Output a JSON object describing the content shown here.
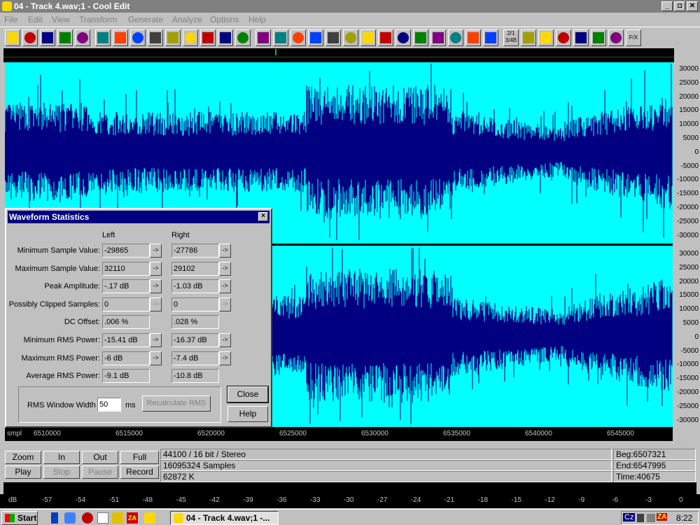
{
  "window": {
    "title": "04 - Track  4.wav;1 - Cool Edit",
    "min": "_",
    "max": "◘",
    "close": "✕"
  },
  "menu": [
    "File",
    "Edit",
    "View",
    "Transform",
    "Generate",
    "Analyze",
    "Options",
    "Help"
  ],
  "toolbar": {
    "time_ratio_top": "2/1",
    "time_ratio_bottom": "3/4B",
    "fx_label": "F/X",
    "icons": [
      "open-icon",
      "folder-icon",
      "save-icon",
      "save-selection-icon",
      "headphones-icon",
      "rewind-icon",
      "stop-bar-icon",
      "loop-icon",
      "note-icon",
      "record-icon",
      "import-icon",
      "silence-icon",
      "envelope-icon",
      "reverb-icon",
      "noise-icon",
      "compressor-icon",
      "filter-icon",
      "echo-icon",
      "flanger-icon",
      "pitch-icon",
      "spectrum-icon",
      "delay-icon",
      "wave-icon",
      "stretch-icon",
      "crossfade-icon",
      "graph-icon",
      "clip-icon",
      "dc-icon",
      "time-icon",
      "help-icon",
      "refresh-icon",
      "meter-icon",
      "scroll-icon",
      "scan-icon",
      "info-icon",
      "bracket-icon"
    ]
  },
  "y_axis_top": [
    "30000",
    "25000",
    "20000",
    "15000",
    "10000",
    "5000",
    "0",
    "-5000",
    "-10000",
    "-15000",
    "-20000",
    "-25000",
    "-30000"
  ],
  "y_axis_bottom": [
    "30000",
    "25000",
    "20000",
    "15000",
    "10000",
    "5000",
    "0",
    "-5000",
    "-10000",
    "-15000",
    "-20000",
    "-25000",
    "-30000"
  ],
  "x_axis": {
    "unit": "smpl",
    "ticks": [
      "6510000",
      "6515000",
      "6520000",
      "6525000",
      "6530000",
      "6535000",
      "6540000",
      "6545000"
    ]
  },
  "controls": {
    "zoom": "Zoom",
    "in": "In",
    "out": "Out",
    "full": "Full",
    "play": "Play",
    "stop": "Stop",
    "pause": "Pause",
    "record": "Record"
  },
  "info": {
    "format": "44100 / 16 bit / Stereo",
    "samples": "16095324 Samples",
    "size": "62872 K",
    "begin": "Beg:6507321",
    "end": "End:6547995",
    "time": "Time:40675"
  },
  "db_scale": [
    "dB",
    "-57",
    "-54",
    "-51",
    "-48",
    "-45",
    "-42",
    "-39",
    "-36",
    "-33",
    "-30",
    "-27",
    "-24",
    "-21",
    "-18",
    "-15",
    "-12",
    "-9",
    "-6",
    "-3",
    "0"
  ],
  "dialog": {
    "title": "Waveform Statistics",
    "close": "×",
    "col_left": "Left",
    "col_right": "Right",
    "rows": [
      {
        "label": "Minimum Sample Value:",
        "left": "-29865",
        "right": "-27786",
        "arrow": true,
        "arrow_enabled": true
      },
      {
        "label": "Maximum Sample Value:",
        "left": "32110",
        "right": "29102",
        "arrow": true,
        "arrow_enabled": true
      },
      {
        "label": "Peak Amplitude:",
        "left": "-.17 dB",
        "right": "-1.03 dB",
        "arrow": true,
        "arrow_enabled": true
      },
      {
        "label": "Possibly Clipped Samples:",
        "left": "0",
        "right": "0",
        "arrow": true,
        "arrow_enabled": false
      },
      {
        "label": "DC Offset:",
        "left": ".006 %",
        "right": ".028 %",
        "arrow": false,
        "arrow_enabled": false
      },
      {
        "label": "Minimum RMS Power:",
        "left": "-15.41 dB",
        "right": "-16.37 dB",
        "arrow": true,
        "arrow_enabled": true
      },
      {
        "label": "Maximum RMS Power:",
        "left": "-6 dB",
        "right": "-7.4 dB",
        "arrow": true,
        "arrow_enabled": true
      },
      {
        "label": "Average RMS Power:",
        "left": "-9.1 dB",
        "right": "-10.8 dB",
        "arrow": false,
        "arrow_enabled": false
      }
    ],
    "arrow_glyph": "->",
    "rms_window_label": "RMS Window Width",
    "rms_window_value": "50",
    "rms_window_unit": "ms",
    "recalculate": "Recalculate RMS",
    "close_button": "Close",
    "help_button": "Help"
  },
  "taskbar": {
    "start": "Start",
    "task": "04 - Track  4.wav;1 -...",
    "tray_lang": "Cz",
    "tray_za": "ZA",
    "clock": "8:22"
  },
  "colors": {
    "wave_bg": "#00ffff",
    "wave": "#000080",
    "dialog_title": "#000080"
  }
}
